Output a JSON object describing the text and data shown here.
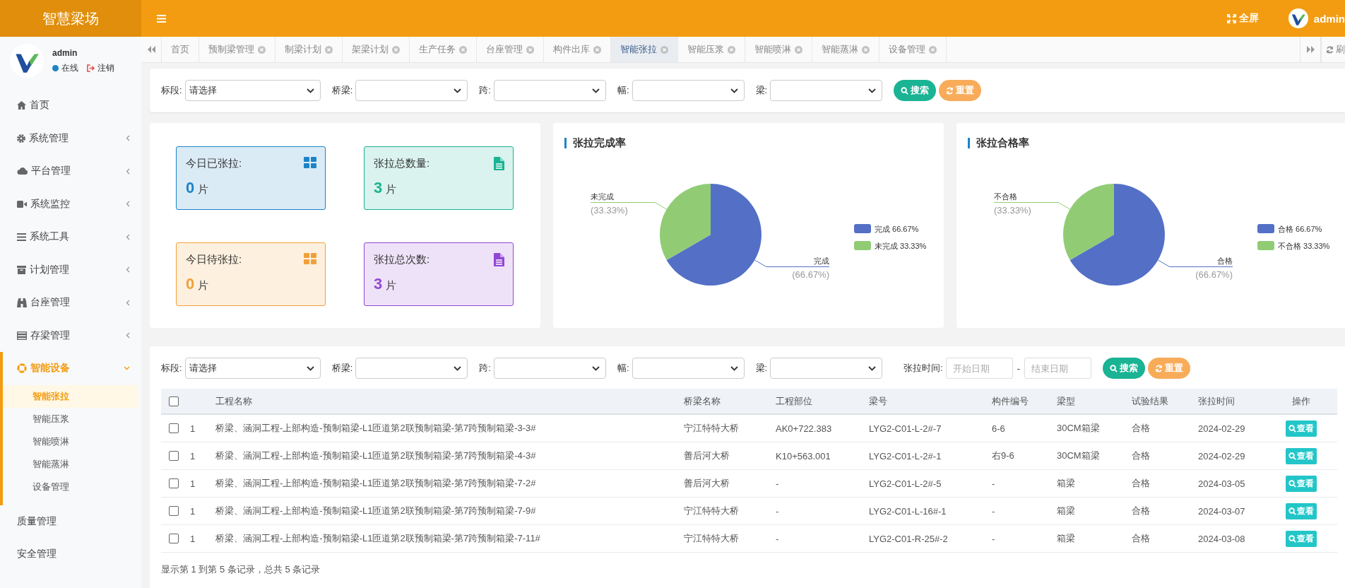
{
  "header": {
    "brand": "智慧梁场",
    "fullscreen": "全屏",
    "user": "admin"
  },
  "sidebar": {
    "user": {
      "name": "admin",
      "status": "在线",
      "logout": "注销"
    },
    "items": [
      {
        "kind": "link",
        "label": "首页"
      },
      {
        "kind": "menu",
        "label": "系统管理",
        "expanded": false
      },
      {
        "kind": "menu",
        "label": "平台管理",
        "expanded": false
      },
      {
        "kind": "menu",
        "label": "系统监控",
        "expanded": false
      },
      {
        "kind": "menu",
        "label": "系统工具",
        "expanded": false
      },
      {
        "kind": "menu",
        "label": "计划管理",
        "expanded": false
      },
      {
        "kind": "menu",
        "label": "台座管理",
        "expanded": false
      },
      {
        "kind": "menu",
        "label": "存梁管理",
        "expanded": false
      },
      {
        "kind": "menu",
        "label": "智能设备",
        "expanded": true,
        "children": [
          {
            "label": "智能张拉",
            "selected": true
          },
          {
            "label": "智能压浆",
            "selected": false
          },
          {
            "label": "智能喷淋",
            "selected": false
          },
          {
            "label": "智能蒸淋",
            "selected": false
          },
          {
            "label": "设备管理",
            "selected": false
          }
        ]
      },
      {
        "kind": "link",
        "label": "质量管理"
      },
      {
        "kind": "link",
        "label": "安全管理"
      }
    ]
  },
  "tabs": [
    {
      "label": "首页",
      "selected": false,
      "closable": false
    },
    {
      "label": "预制梁管理",
      "selected": false,
      "closable": true
    },
    {
      "label": "制梁计划",
      "selected": false,
      "closable": true
    },
    {
      "label": "架梁计划",
      "selected": false,
      "closable": true
    },
    {
      "label": "生产任务",
      "selected": false,
      "closable": true
    },
    {
      "label": "台座管理",
      "selected": false,
      "closable": true
    },
    {
      "label": "构件出库",
      "selected": false,
      "closable": true
    },
    {
      "label": "智能张拉",
      "selected": true,
      "closable": true
    },
    {
      "label": "智能压浆",
      "selected": false,
      "closable": true
    },
    {
      "label": "智能喷淋",
      "selected": false,
      "closable": true
    },
    {
      "label": "智能蒸淋",
      "selected": false,
      "closable": true
    },
    {
      "label": "设备管理",
      "selected": false,
      "closable": true
    }
  ],
  "tab_tools": {
    "refresh": "刷"
  },
  "filters": {
    "fields": [
      {
        "kind": "select",
        "label": "标段:",
        "value": "请选择"
      },
      {
        "kind": "select",
        "label": "桥梁:"
      },
      {
        "kind": "select",
        "label": "跨:"
      },
      {
        "kind": "select",
        "label": "幅:"
      },
      {
        "kind": "select",
        "label": "梁:"
      }
    ],
    "buttons": [
      {
        "kind": "search",
        "label": "搜索"
      },
      {
        "kind": "reset",
        "label": "重置"
      }
    ]
  },
  "stats": [
    {
      "label": "今日已张拉:",
      "value": "0",
      "unit": "片",
      "color": "#1c84c6"
    },
    {
      "label": "张拉总数量:",
      "value": "3",
      "unit": "片",
      "color": "#1ab394"
    },
    {
      "label": "今日待张拉:",
      "value": "0",
      "unit": "片",
      "color": "#f0a03a"
    },
    {
      "label": "张拉总次数:",
      "value": "3",
      "unit": "片",
      "color": "#9247d4"
    }
  ],
  "charts": [
    {
      "chart_data": {
        "type": "pie",
        "title": "张拉完成率",
        "categories": [
          "完成",
          "未完成"
        ],
        "series": [
          {
            "values": [
              66.67,
              33.33
            ]
          }
        ],
        "value_labels": [
          "(66.67%)",
          "(33.33%)"
        ]
      },
      "legend": [
        {
          "text": "完成 66.67%",
          "color": "#5470c6"
        },
        {
          "text": "未完成 33.33%",
          "color": "#91cc75"
        }
      ]
    },
    {
      "chart_data": {
        "type": "pie",
        "title": "张拉合格率",
        "categories": [
          "合格",
          "不合格"
        ],
        "series": [
          {
            "values": [
              66.67,
              33.33
            ]
          }
        ],
        "value_labels": [
          "(66.67%)",
          "(33.33%)"
        ]
      },
      "legend": [
        {
          "text": "合格 66.67%",
          "color": "#5470c6"
        },
        {
          "text": "不合格 33.33%",
          "color": "#91cc75"
        }
      ]
    }
  ],
  "table_filters": {
    "fields": [
      {
        "kind": "select",
        "label": "标段:",
        "value": "请选择"
      },
      {
        "kind": "select",
        "label": "桥梁:"
      },
      {
        "kind": "select",
        "label": "跨:"
      },
      {
        "kind": "select",
        "label": "幅:"
      },
      {
        "kind": "select",
        "label": "梁:"
      },
      {
        "kind": "date_range",
        "label": "张拉时间:",
        "start_placeholder": "开始日期",
        "separator": "-",
        "end_placeholder": "结束日期"
      }
    ],
    "buttons": [
      {
        "kind": "search",
        "label": "搜索"
      },
      {
        "kind": "reset",
        "label": "重置"
      }
    ]
  },
  "table": {
    "select_all": {
      "checked": false
    },
    "columns": [
      "",
      "工程名称",
      "桥梁名称",
      "工程部位",
      "梁号",
      "构件编号",
      "梁型",
      "试验结果",
      "张拉时间",
      "操作"
    ],
    "rows": [
      {
        "checked": false,
        "cells": [
          "1",
          "桥梁、涵洞工程-上部构造-预制箱梁-L1匝道第2联预制箱梁-第7跨预制箱梁-3-3#",
          "宁江特特大桥",
          "AK0+722.383",
          "LYG2-C01-L-2#-7",
          "6-6",
          "30CM箱梁",
          "合格",
          "2024-02-29"
        ],
        "action": "查看"
      },
      {
        "checked": false,
        "cells": [
          "1",
          "桥梁、涵洞工程-上部构造-预制箱梁-L1匝道第2联预制箱梁-第7跨预制箱梁-4-3#",
          "善后河大桥",
          "K10+563.001",
          "LYG2-C01-L-2#-1",
          "右9-6",
          "30CM箱梁",
          "合格",
          "2024-02-29"
        ],
        "action": "查看"
      },
      {
        "checked": false,
        "cells": [
          "1",
          "桥梁、涵洞工程-上部构造-预制箱梁-L1匝道第2联预制箱梁-第7跨预制箱梁-7-2#",
          "善后河大桥",
          "-",
          "LYG2-C01-L-2#-5",
          "-",
          "箱梁",
          "合格",
          "2024-03-05"
        ],
        "action": "查看"
      },
      {
        "checked": false,
        "cells": [
          "1",
          "桥梁、涵洞工程-上部构造-预制箱梁-L1匝道第2联预制箱梁-第7跨预制箱梁-7-9#",
          "宁江特特大桥",
          "-",
          "LYG2-C01-L-16#-1",
          "-",
          "箱梁",
          "合格",
          "2024-03-07"
        ],
        "action": "查看"
      },
      {
        "checked": false,
        "cells": [
          "1",
          "桥梁、涵洞工程-上部构造-预制箱梁-L1匝道第2联预制箱梁-第7跨预制箱梁-7-11#",
          "宁江特特大桥",
          "-",
          "LYG2-C01-R-25#-2",
          "-",
          "箱梁",
          "合格",
          "2024-03-08"
        ],
        "action": "查看"
      }
    ],
    "footer": "显示第 1 到第 5 条记录，总共 5 条记录"
  }
}
